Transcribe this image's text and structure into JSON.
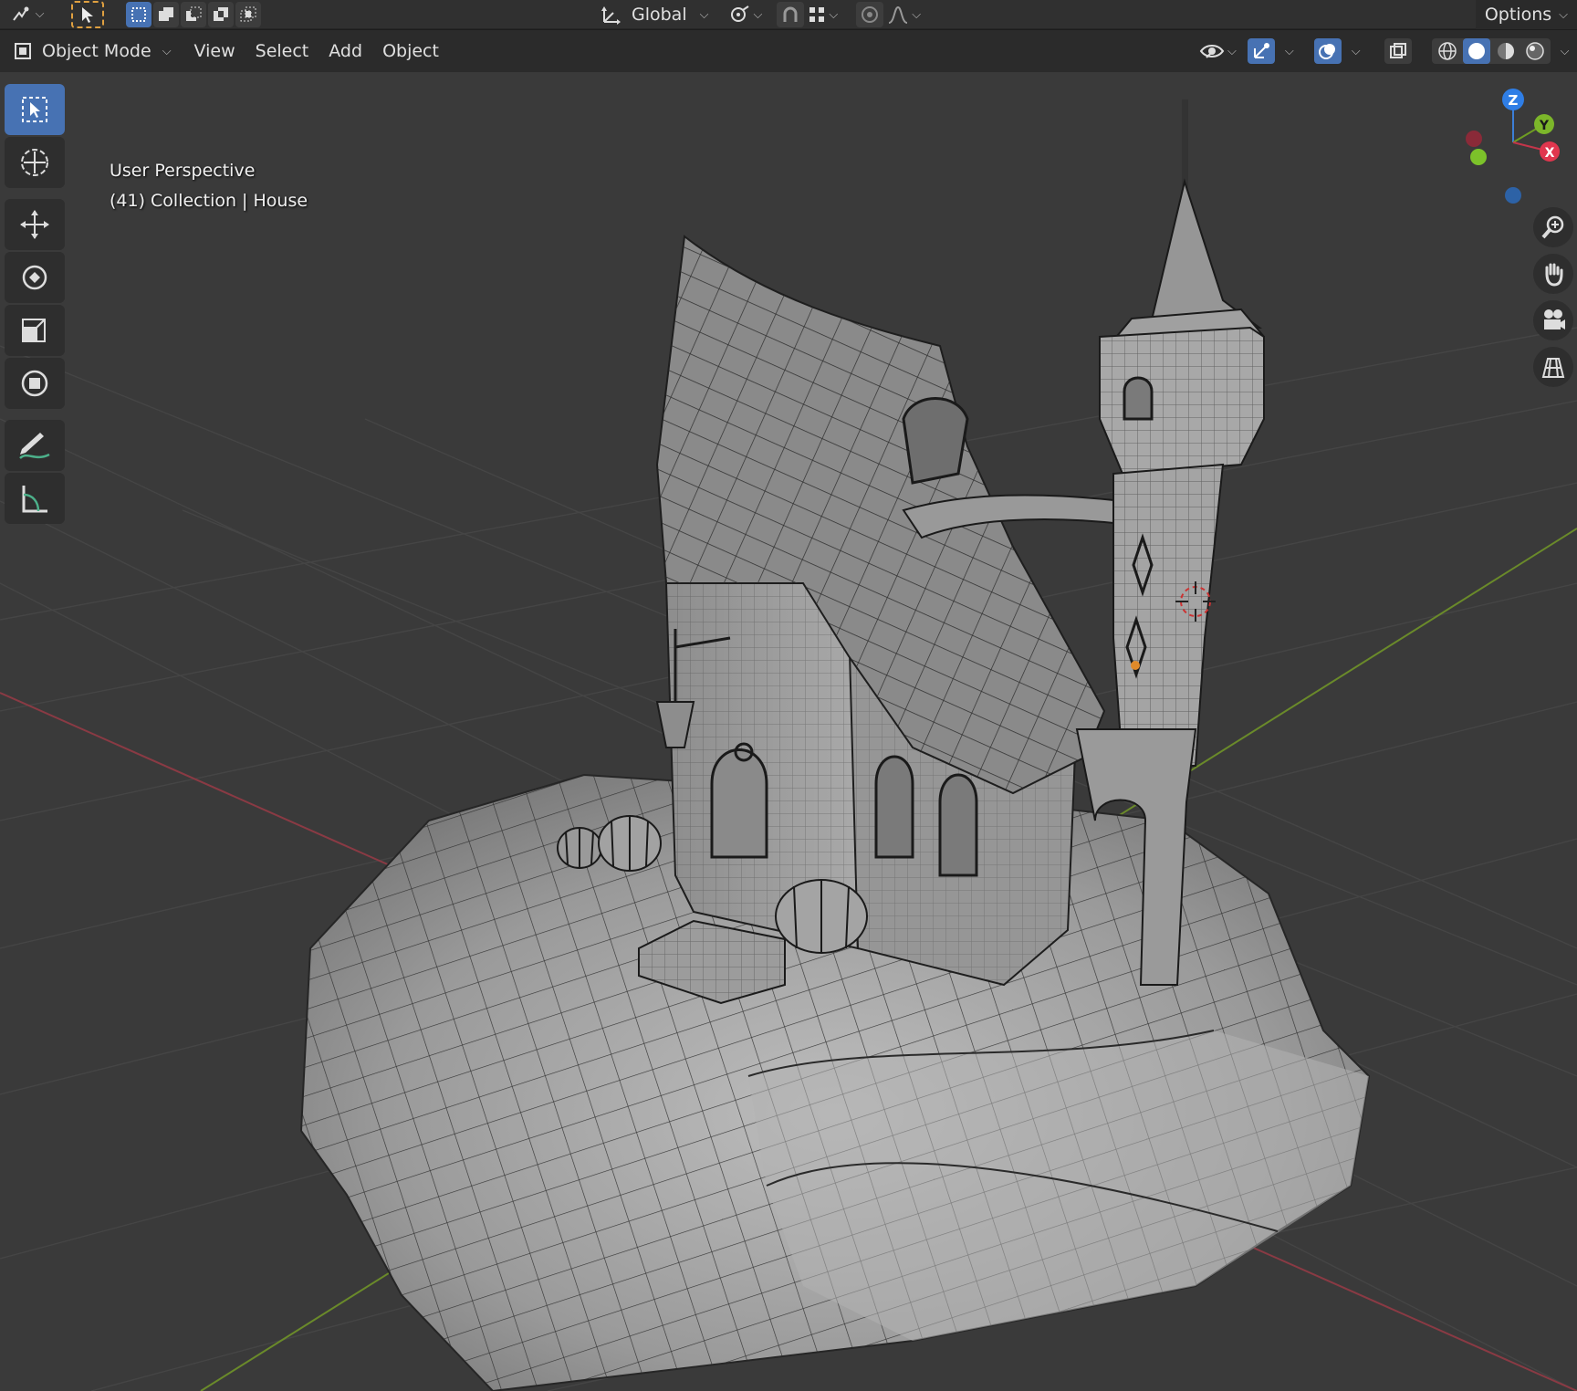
{
  "topbar": {
    "transform_orientation": "Global",
    "options_label": "Options",
    "icons": [
      "editor-type-icon",
      "select-cursor-icon",
      "mode-new-icon",
      "mode-extend-icon",
      "mode-subtract-icon",
      "mode-difference-icon",
      "mode-intersect-icon",
      "transform-orientation-icon",
      "pivot-point-icon",
      "snap-icon",
      "snap-increment-icon",
      "proportional-edit-icon",
      "falloff-icon"
    ]
  },
  "header": {
    "mode_label": "Object Mode",
    "menus": [
      "View",
      "Select",
      "Add",
      "Object"
    ],
    "icons": [
      "visibility-icon",
      "gizmo-icon",
      "overlay-icon",
      "xray-icon",
      "wireframe-shading-icon",
      "solid-shading-icon",
      "material-shading-icon",
      "rendered-shading-icon"
    ]
  },
  "viewport": {
    "perspective_label": "User Perspective",
    "collection_label": "(41) Collection | House",
    "colors": {
      "background": "#3a3a3a",
      "grid": "#464646",
      "x_axis": "#8a3a44",
      "y_axis": "#6a8a2a",
      "mesh": "#a8a8a8",
      "wire": "#1e1e1e"
    }
  },
  "toolbar": {
    "tools": [
      "select-box-icon",
      "cursor-icon",
      "move-icon",
      "rotate-icon",
      "scale-icon",
      "transform-icon",
      "annotate-icon",
      "measure-icon"
    ]
  },
  "gizmo": {
    "z_label": "Z",
    "y_label": "Y",
    "x_label": "X",
    "nav_buttons": [
      "zoom-icon",
      "pan-hand-icon",
      "camera-icon",
      "ortho-grid-icon"
    ]
  }
}
